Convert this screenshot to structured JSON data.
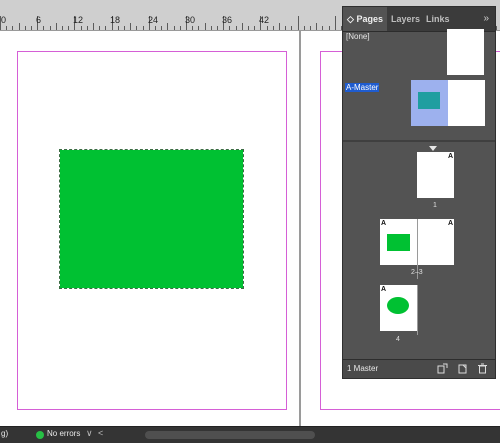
{
  "ruler": {
    "labels": [
      "0",
      "6",
      "12",
      "18",
      "24",
      "30",
      "36",
      "42"
    ]
  },
  "panel": {
    "tabs": [
      {
        "label": "◇ Pages",
        "active": true
      },
      {
        "label": "Layers",
        "active": false
      },
      {
        "label": "Links",
        "active": false
      }
    ],
    "menu_icon": "»",
    "masters": [
      {
        "label": "[None]",
        "selected": false
      },
      {
        "label": "A-Master",
        "selected": true
      }
    ],
    "pages": [
      {
        "number": "1",
        "letter": "A"
      },
      {
        "number": "2–3",
        "letters": [
          "A",
          "A"
        ]
      },
      {
        "number": "4",
        "letter": "A"
      }
    ],
    "footer": {
      "text": "1 Master",
      "icons": [
        "new-page-size-icon",
        "new-page-icon",
        "delete-icon"
      ]
    }
  },
  "status": {
    "left_text": "g)",
    "errors": "No errors",
    "dropdown_icon": "∨",
    "prev_icon": "<"
  },
  "colors": {
    "accent_green": "#00c132",
    "status_ok": "#27c045",
    "selection_blue": "#1f5ccf",
    "teal": "#1f9ea0"
  }
}
